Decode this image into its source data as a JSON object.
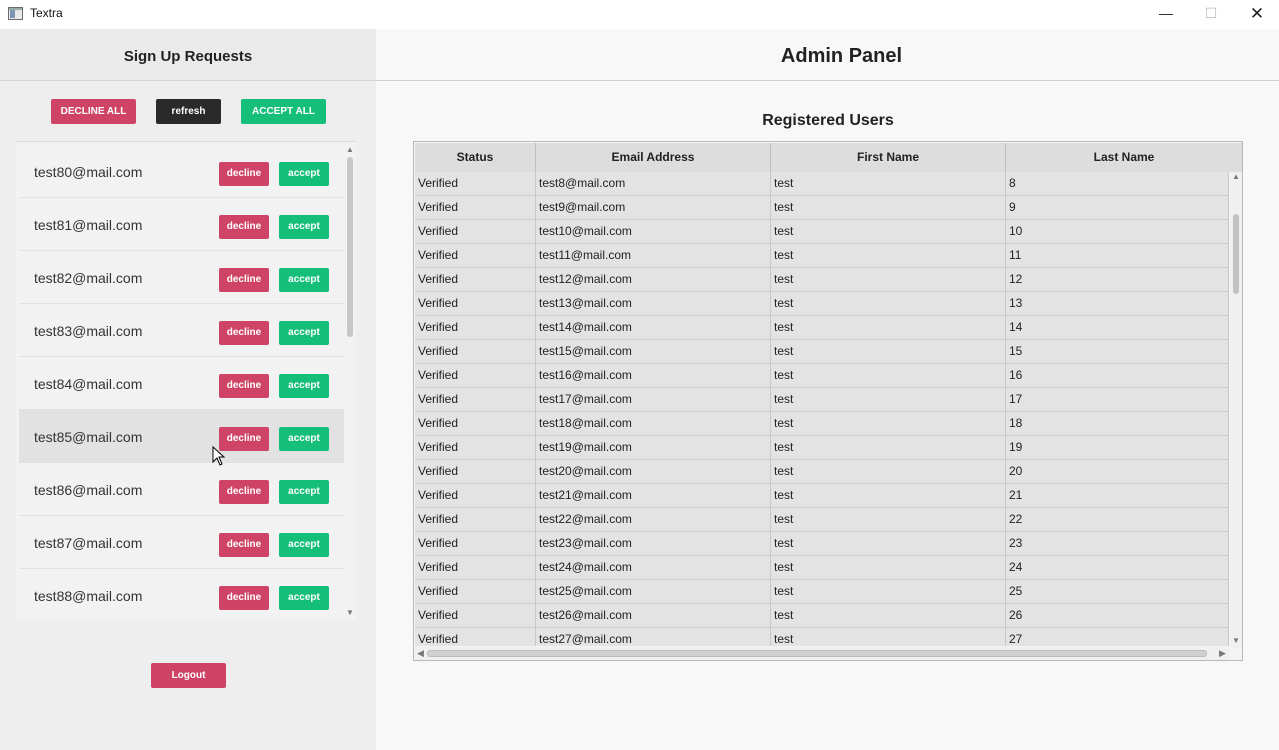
{
  "window": {
    "title": "Textra",
    "minimize": "—",
    "maximize": "☐",
    "close": "✕"
  },
  "sidebar": {
    "title": "Sign Up Requests",
    "decline_all": "DECLINE ALL",
    "refresh": "refresh",
    "accept_all": "ACCEPT ALL",
    "decline_label": "decline",
    "accept_label": "accept",
    "requests": [
      "test80@mail.com",
      "test81@mail.com",
      "test82@mail.com",
      "test83@mail.com",
      "test84@mail.com",
      "test85@mail.com",
      "test86@mail.com",
      "test87@mail.com",
      "test88@mail.com"
    ],
    "logout": "Logout",
    "scroll_up": "▲",
    "scroll_down": "▼"
  },
  "main": {
    "title": "Admin Panel",
    "section_title": "Registered Users",
    "table": {
      "columns": [
        "Status",
        "Email Address",
        "First Name",
        "Last Name"
      ],
      "rows": [
        [
          "Verified",
          "test8@mail.com",
          "test",
          "8"
        ],
        [
          "Verified",
          "test9@mail.com",
          "test",
          "9"
        ],
        [
          "Verified",
          "test10@mail.com",
          "test",
          "10"
        ],
        [
          "Verified",
          "test11@mail.com",
          "test",
          "11"
        ],
        [
          "Verified",
          "test12@mail.com",
          "test",
          "12"
        ],
        [
          "Verified",
          "test13@mail.com",
          "test",
          "13"
        ],
        [
          "Verified",
          "test14@mail.com",
          "test",
          "14"
        ],
        [
          "Verified",
          "test15@mail.com",
          "test",
          "15"
        ],
        [
          "Verified",
          "test16@mail.com",
          "test",
          "16"
        ],
        [
          "Verified",
          "test17@mail.com",
          "test",
          "17"
        ],
        [
          "Verified",
          "test18@mail.com",
          "test",
          "18"
        ],
        [
          "Verified",
          "test19@mail.com",
          "test",
          "19"
        ],
        [
          "Verified",
          "test20@mail.com",
          "test",
          "20"
        ],
        [
          "Verified",
          "test21@mail.com",
          "test",
          "21"
        ],
        [
          "Verified",
          "test22@mail.com",
          "test",
          "22"
        ],
        [
          "Verified",
          "test23@mail.com",
          "test",
          "23"
        ],
        [
          "Verified",
          "test24@mail.com",
          "test",
          "24"
        ],
        [
          "Verified",
          "test25@mail.com",
          "test",
          "25"
        ],
        [
          "Verified",
          "test26@mail.com",
          "test",
          "26"
        ],
        [
          "Verified",
          "test27@mail.com",
          "test",
          "27"
        ]
      ]
    }
  }
}
